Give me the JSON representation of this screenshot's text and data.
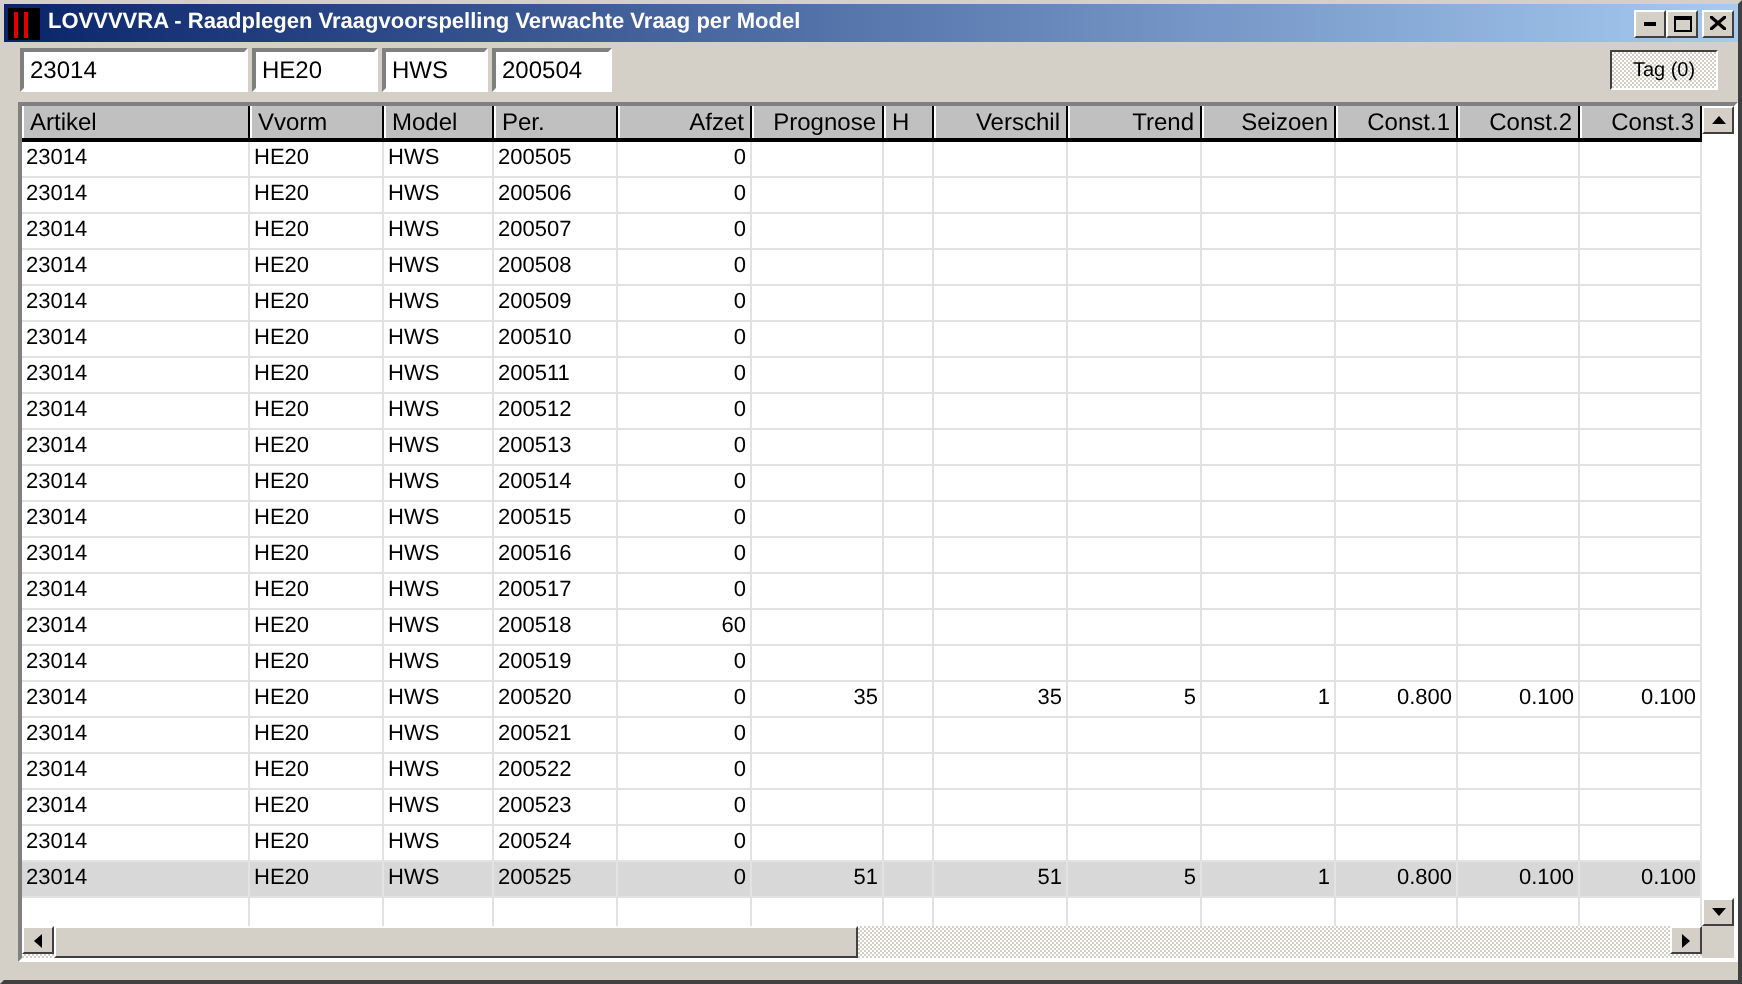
{
  "window": {
    "title": "LOVVVVRA - Raadplegen Vraagvoorspelling Verwachte Vraag per Model"
  },
  "filters": [
    {
      "value": "23014"
    },
    {
      "value": "HE20"
    },
    {
      "value": "HWS"
    },
    {
      "value": "200504"
    }
  ],
  "tag_button": {
    "label": "Tag (0)"
  },
  "table": {
    "columns": [
      "Artikel",
      "Vvorm",
      "Model",
      "Per.",
      "Afzet",
      "Prognose",
      "H",
      "Verschil",
      "Trend",
      "Seizoen",
      "Const.1",
      "Const.2",
      "Const.3"
    ],
    "rows": [
      {
        "selected": false,
        "artikel": "23014",
        "vvorm": "HE20",
        "model": "HWS",
        "per": "200505",
        "afzet": "0"
      },
      {
        "selected": false,
        "artikel": "23014",
        "vvorm": "HE20",
        "model": "HWS",
        "per": "200506",
        "afzet": "0"
      },
      {
        "selected": false,
        "artikel": "23014",
        "vvorm": "HE20",
        "model": "HWS",
        "per": "200507",
        "afzet": "0"
      },
      {
        "selected": false,
        "artikel": "23014",
        "vvorm": "HE20",
        "model": "HWS",
        "per": "200508",
        "afzet": "0"
      },
      {
        "selected": false,
        "artikel": "23014",
        "vvorm": "HE20",
        "model": "HWS",
        "per": "200509",
        "afzet": "0"
      },
      {
        "selected": false,
        "artikel": "23014",
        "vvorm": "HE20",
        "model": "HWS",
        "per": "200510",
        "afzet": "0"
      },
      {
        "selected": false,
        "artikel": "23014",
        "vvorm": "HE20",
        "model": "HWS",
        "per": "200511",
        "afzet": "0"
      },
      {
        "selected": false,
        "artikel": "23014",
        "vvorm": "HE20",
        "model": "HWS",
        "per": "200512",
        "afzet": "0"
      },
      {
        "selected": false,
        "artikel": "23014",
        "vvorm": "HE20",
        "model": "HWS",
        "per": "200513",
        "afzet": "0"
      },
      {
        "selected": false,
        "artikel": "23014",
        "vvorm": "HE20",
        "model": "HWS",
        "per": "200514",
        "afzet": "0"
      },
      {
        "selected": false,
        "artikel": "23014",
        "vvorm": "HE20",
        "model": "HWS",
        "per": "200515",
        "afzet": "0"
      },
      {
        "selected": false,
        "artikel": "23014",
        "vvorm": "HE20",
        "model": "HWS",
        "per": "200516",
        "afzet": "0"
      },
      {
        "selected": false,
        "artikel": "23014",
        "vvorm": "HE20",
        "model": "HWS",
        "per": "200517",
        "afzet": "0"
      },
      {
        "selected": false,
        "artikel": "23014",
        "vvorm": "HE20",
        "model": "HWS",
        "per": "200518",
        "afzet": "60"
      },
      {
        "selected": false,
        "artikel": "23014",
        "vvorm": "HE20",
        "model": "HWS",
        "per": "200519",
        "afzet": "0"
      },
      {
        "selected": false,
        "artikel": "23014",
        "vvorm": "HE20",
        "model": "HWS",
        "per": "200520",
        "afzet": "0",
        "prognose": "35",
        "verschil": "35",
        "trend": "5",
        "seizoen": "1",
        "const_1": "0.800",
        "const_2": "0.100",
        "const_3": "0.100"
      },
      {
        "selected": false,
        "artikel": "23014",
        "vvorm": "HE20",
        "model": "HWS",
        "per": "200521",
        "afzet": "0"
      },
      {
        "selected": false,
        "artikel": "23014",
        "vvorm": "HE20",
        "model": "HWS",
        "per": "200522",
        "afzet": "0"
      },
      {
        "selected": false,
        "artikel": "23014",
        "vvorm": "HE20",
        "model": "HWS",
        "per": "200523",
        "afzet": "0"
      },
      {
        "selected": false,
        "artikel": "23014",
        "vvorm": "HE20",
        "model": "HWS",
        "per": "200524",
        "afzet": "0"
      },
      {
        "selected": true,
        "artikel": "23014",
        "vvorm": "HE20",
        "model": "HWS",
        "per": "200525",
        "afzet": "0",
        "prognose": "51",
        "verschil": "51",
        "trend": "5",
        "seizoen": "1",
        "const_1": "0.800",
        "const_2": "0.100",
        "const_3": "0.100"
      }
    ]
  }
}
